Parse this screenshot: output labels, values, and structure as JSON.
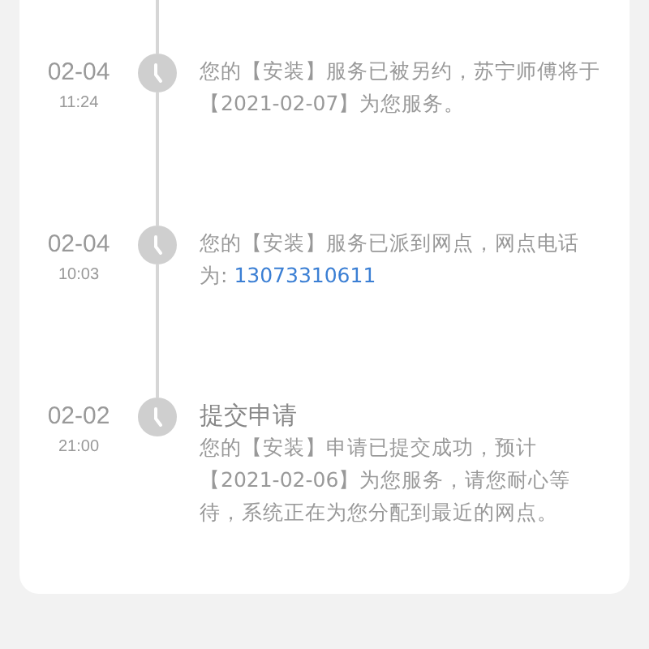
{
  "timeline": [
    {
      "date": "02-04",
      "time": "11:24",
      "message": "您的【安装】服务已被另约，苏宁师傅将于【2021-02-07】为您服务。"
    },
    {
      "date": "02-04",
      "time": "10:03",
      "message": "您的【安装】服务已派到网点，网点电话为: ",
      "phone": "13073310611"
    },
    {
      "date": "02-02",
      "time": "21:00",
      "title": "提交申请",
      "message": "您的【安装】申请已提交成功，预计【2021-02-06】为您服务，请您耐心等待，系统正在为您分配到最近的网点。"
    }
  ]
}
